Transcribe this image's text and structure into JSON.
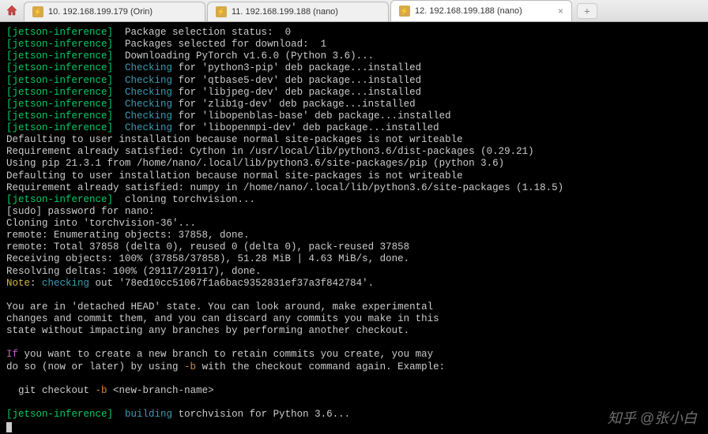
{
  "tabs": [
    {
      "label": "10. 192.168.199.179 (Orin)",
      "active": false
    },
    {
      "label": "11. 192.168.199.188 (nano)",
      "active": false
    },
    {
      "label": "12. 192.168.199.188 (nano)",
      "active": true
    }
  ],
  "terminal": {
    "prefix": "[jetson-inference]",
    "lines": {
      "l1": "  Package selection status:  0",
      "l2": "  Packages selected for download:  1",
      "l3": "  Downloading PyTorch v1.6.0 (Python 3.6)...",
      "chk": "Checking",
      "p1a": " for 'python3-pip' deb package...installed",
      "p2a": " for 'qtbase5-dev' deb package...installed",
      "p3a": " for 'libjpeg-dev' deb package...installed",
      "p4a": " for 'zlib1g-dev' deb package...installed",
      "p5a": " for 'libopenblas-base' deb package...installed",
      "p6a": " for 'libopenmpi-dev' deb package...installed",
      "d1": "Defaulting to user installation because normal site-packages is not writeable",
      "d2": "Requirement already satisfied: Cython in /usr/local/lib/python3.6/dist-packages (0.29.21)",
      "d3": "Using pip 21.3.1 from /home/nano/.local/lib/python3.6/site-packages/pip (python 3.6)",
      "d4": "Defaulting to user installation because normal site-packages is not writeable",
      "d5": "Requirement already satisfied: numpy in /home/nano/.local/lib/python3.6/site-packages (1.18.5)",
      "d6": "  cloning torchvision...",
      "d7": "[sudo] password for nano:",
      "d8": "Cloning into 'torchvision-36'...",
      "d9": "remote: Enumerating objects: 37858, done.",
      "d10": "remote: Total 37858 (delta 0), reused 0 (delta 0), pack-reused 37858",
      "d11": "Receiving objects: 100% (37858/37858), 51.28 MiB | 4.63 MiB/s, done.",
      "d12": "Resolving deltas: 100% (29117/29117), done.",
      "note": "Note",
      "checking": "checking",
      "note_tail": " out '78ed10cc51067f1a6bac9352831ef37a3f842784'.",
      "h1": "You are in 'detached HEAD' state. You can look around, make experimental",
      "h2": "changes and commit them, and you can discard any commits you make in this",
      "h3": "state without impacting any branches by performing another checkout.",
      "if": "If",
      "if_tail": " you want to create a new branch to retain commits you create, you may",
      "if_l2a": "do so (now or later) by using ",
      "dash_b": "-b",
      "if_l2b": " with the checkout command again. Example:",
      "gc": "  git checkout ",
      "gc_b": "-b",
      "gc_tail": " <new-branch-name>",
      "building": "building",
      "build_tail": " torchvision for Python 3.6..."
    }
  },
  "watermark": "知乎 @张小白"
}
